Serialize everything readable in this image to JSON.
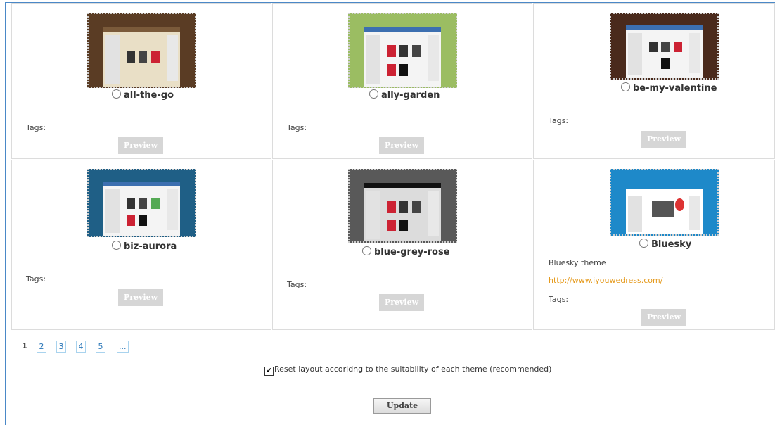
{
  "themes": [
    {
      "name": "all-the-go",
      "tags_label": "Tags:",
      "preview_label": "Preview",
      "thumb_bg": "#5a3c24",
      "thumb_accent": "#e9dfc6"
    },
    {
      "name": "ally-garden",
      "tags_label": "Tags:",
      "preview_label": "Preview",
      "thumb_bg": "#9bbd62",
      "thumb_accent": "#f4f4f4"
    },
    {
      "name": "be-my-valentine",
      "tags_label": "Tags:",
      "preview_label": "Preview",
      "thumb_bg": "#4a2a1c",
      "thumb_accent": "#f4f4f4"
    },
    {
      "name": "biz-aurora",
      "tags_label": "Tags:",
      "preview_label": "Preview",
      "thumb_bg": "#1f5f86",
      "thumb_accent": "#f4f4f4"
    },
    {
      "name": "blue-grey-rose",
      "tags_label": "Tags:",
      "preview_label": "Preview",
      "thumb_bg": "#595959",
      "thumb_accent": "#dcdcdc"
    },
    {
      "name": "Bluesky",
      "description": "Bluesky theme",
      "url": "http://www.iyouwedress.com/",
      "tags_label": "Tags:",
      "preview_label": "Preview",
      "thumb_bg": "#1e89c9",
      "thumb_accent": "#ffffff"
    }
  ],
  "pagination": {
    "pages": [
      "1",
      "2",
      "3",
      "4",
      "5",
      "..."
    ],
    "current": "1"
  },
  "reset_option": {
    "checked": true,
    "label": "Reset layout accoridng to the suitability of each theme (recommended)"
  },
  "update_label": "Update"
}
